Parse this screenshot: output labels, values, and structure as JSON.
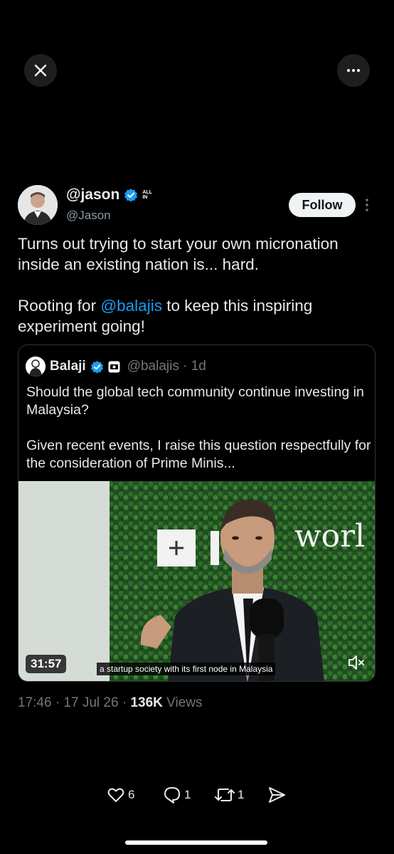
{
  "author": {
    "display_name": "@jason",
    "handle": "@Jason",
    "badge_text": "ALL IN",
    "follow_label": "Follow"
  },
  "tweet": {
    "text_line1": "Turns out trying to start your own micronation inside an existing nation is... hard.",
    "text_pre_mention": "Rooting for ",
    "mention": "@balajis",
    "text_post_mention": " to keep this inspiring experiment going!"
  },
  "quote": {
    "name": "Balaji",
    "handle_time": "@balajis · 1d",
    "text": "Should the global tech community continue investing in Malaysia?\n\nGiven recent events, I raise this question respectfully for the consideration of Prime Minis...",
    "video_duration": "31:57",
    "video_caption": "a startup society with its first node in Malaysia",
    "backdrop_text": "worl"
  },
  "meta": {
    "time_date": "17:46 · 17 Jul 26 · ",
    "views_count": "136K",
    "views_label": " Views"
  },
  "actions": {
    "likes": "6",
    "replies": "1",
    "reposts": "1"
  },
  "colors": {
    "background": "#000000",
    "accent": "#1d9bf0",
    "verified": "#1d9bf0",
    "secondary_text": "#71767b"
  }
}
